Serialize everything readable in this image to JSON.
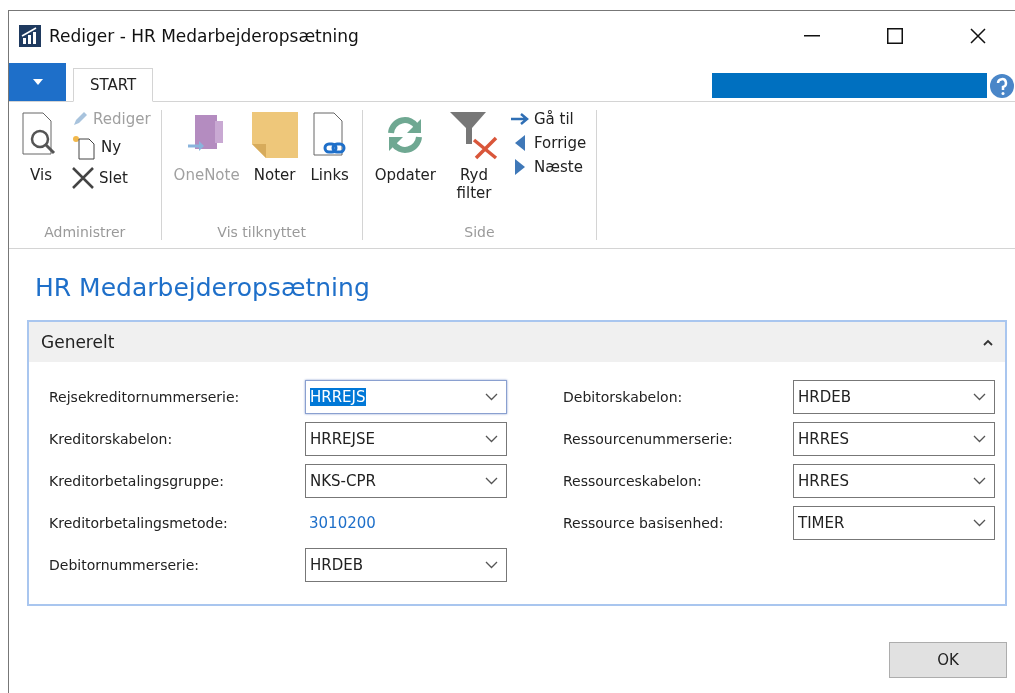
{
  "window": {
    "title": "Rediger - HR Medarbejderopsætning"
  },
  "tabs": [
    {
      "label": "START",
      "selected": true
    }
  ],
  "ribbon": {
    "groups": [
      {
        "label": "Administrer",
        "large": [
          {
            "label": "Vis",
            "disabled": false
          }
        ],
        "small": [
          {
            "label": "Rediger",
            "disabled": true
          },
          {
            "label": "Ny",
            "disabled": false
          },
          {
            "label": "Slet",
            "disabled": false
          }
        ]
      },
      {
        "label": "Vis tilknyttet",
        "large": [
          {
            "label": "OneNote",
            "disabled": true
          },
          {
            "label": "Noter",
            "disabled": false
          },
          {
            "label": "Links",
            "disabled": false
          }
        ]
      },
      {
        "label": "Side",
        "large": [
          {
            "label": "Opdater",
            "disabled": false
          },
          {
            "label": "Ryd filter",
            "disabled": false
          }
        ],
        "small": [
          {
            "label": "Gå til",
            "disabled": false
          },
          {
            "label": "Forrige",
            "disabled": false
          },
          {
            "label": "Næste",
            "disabled": false
          }
        ]
      }
    ]
  },
  "page": {
    "title": "HR Medarbejderopsætning"
  },
  "section": {
    "title": "Generelt",
    "expanded": true,
    "columns": [
      [
        {
          "label": "Rejsekreditornummerserie:",
          "kind": "dropdown",
          "value": "HRREJS",
          "focused": true
        },
        {
          "label": "Kreditorskabelon:",
          "kind": "dropdown",
          "value": "HRREJSE",
          "focused": false
        },
        {
          "label": "Kreditorbetalingsgruppe:",
          "kind": "dropdown",
          "value": "NKS-CPR",
          "focused": false
        },
        {
          "label": "Kreditorbetalingsmetode:",
          "kind": "link",
          "value": "3010200"
        },
        {
          "label": "Debitornummerserie:",
          "kind": "dropdown",
          "value": "HRDEB",
          "focused": false
        }
      ],
      [
        {
          "label": "Debitorskabelon:",
          "kind": "dropdown",
          "value": "HRDEB",
          "focused": false
        },
        {
          "label": "Ressourcenummerserie:",
          "kind": "dropdown",
          "value": "HRRES",
          "focused": false
        },
        {
          "label": "Ressourceskabelon:",
          "kind": "dropdown",
          "value": "HRRES",
          "focused": false
        },
        {
          "label": "Ressource basisenhed:",
          "kind": "dropdown",
          "value": "TIMER",
          "focused": false
        }
      ]
    ]
  },
  "buttons": [
    {
      "label": "OK"
    }
  ]
}
